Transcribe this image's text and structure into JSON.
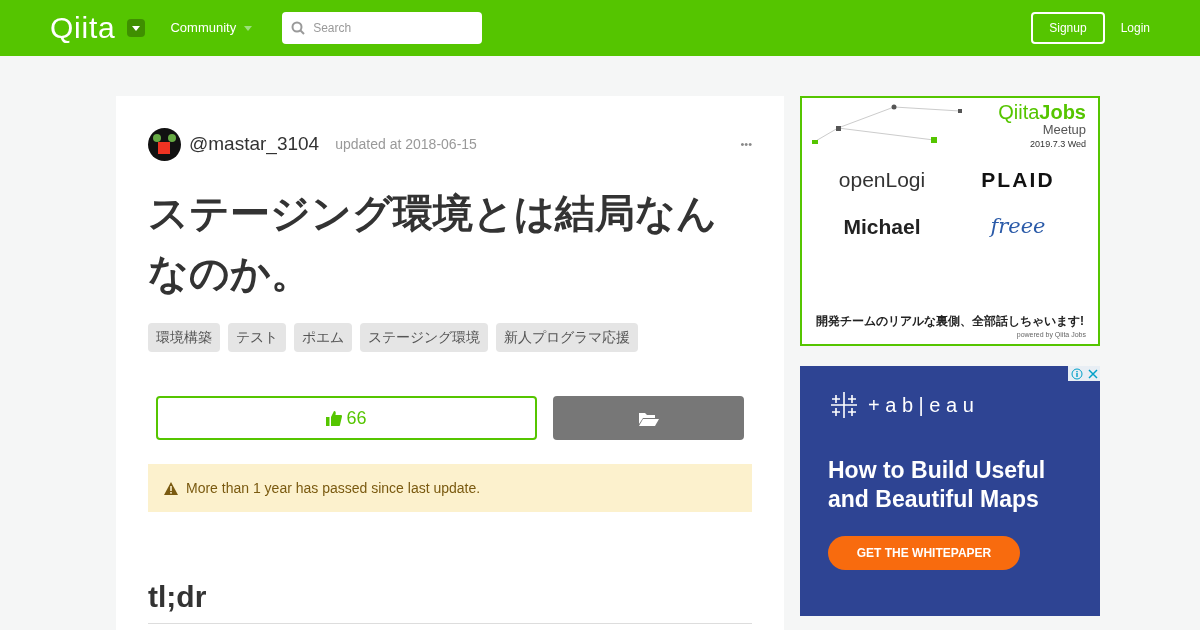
{
  "header": {
    "logo": "Qiita",
    "community": "Community",
    "search": {
      "placeholder": "Search"
    },
    "signup": "Signup",
    "login": "Login"
  },
  "article": {
    "author": "@mastar_3104",
    "updated": "updated at 2018-06-15",
    "menu": "•••",
    "title": "ステージング環境とは結局なんなのか。",
    "tags": [
      "環境構築",
      "テスト",
      "ポエム",
      "ステージング環境",
      "新人プログラマ応援"
    ],
    "likes": "66",
    "liked": false,
    "notice": "More than 1 year has passed since last update.",
    "heading": "tl;dr"
  },
  "ads": [
    {
      "kind": "jobs",
      "brand": "Qiita",
      "brand2": "Jobs",
      "event": "Meetup",
      "date": "2019.7.3 Wed",
      "sponsors": [
        "openLogi",
        "PLAID",
        "Michael",
        "freee"
      ],
      "tagline": "開発チームのリアルな裏側、全部話しちゃいます!",
      "powered": "powered by Qiita Jobs"
    },
    {
      "kind": "tableau",
      "brand": "+ a b | e a u",
      "headline": "How to Build Useful and Beautiful Maps",
      "cta": "GET THE WHITEPAPER"
    }
  ]
}
